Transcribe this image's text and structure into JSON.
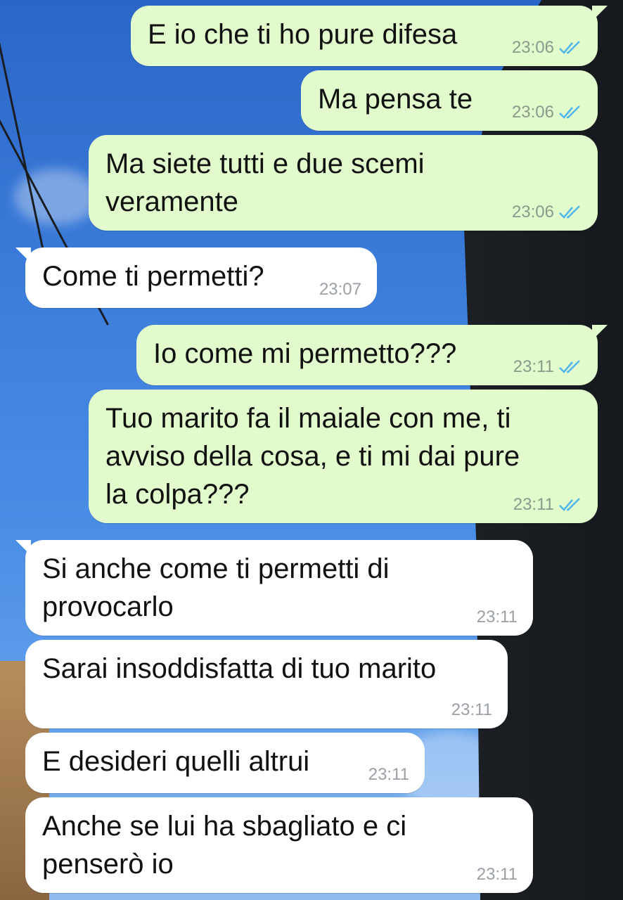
{
  "colors": {
    "outgoing_bubble": "#e2fbcd",
    "incoming_bubble": "#ffffff",
    "read_check": "#4fb6ec"
  },
  "icons": {
    "read_receipt": "double-check-icon"
  },
  "messages": [
    {
      "dir": "out",
      "text": "E io che ti ho pure difesa",
      "time": "23:06",
      "read": true
    },
    {
      "dir": "out",
      "text": "Ma pensa te",
      "time": "23:06",
      "read": true
    },
    {
      "dir": "out",
      "text": "Ma siete tutti e due scemi\nveramente",
      "time": "23:06",
      "read": true
    },
    {
      "dir": "in",
      "text": "Come ti permetti?",
      "time": "23:07"
    },
    {
      "dir": "out",
      "text": "Io come mi permetto???",
      "time": "23:11",
      "read": true
    },
    {
      "dir": "out",
      "text": "Tuo marito fa il maiale con me, ti\navviso della cosa, e ti mi dai pure\nla colpa???",
      "time": "23:11",
      "read": true
    },
    {
      "dir": "in",
      "text": "Si anche come ti permetti di\nprovocarlo",
      "time": "23:11"
    },
    {
      "dir": "in",
      "text": "Sarai insoddisfatta di tuo marito",
      "time": "23:11"
    },
    {
      "dir": "in",
      "text": "E desideri quelli altrui",
      "time": "23:11"
    },
    {
      "dir": "in",
      "text": "Anche se lui ha sbagliato e ci\npenserò io",
      "time": "23:11"
    }
  ]
}
